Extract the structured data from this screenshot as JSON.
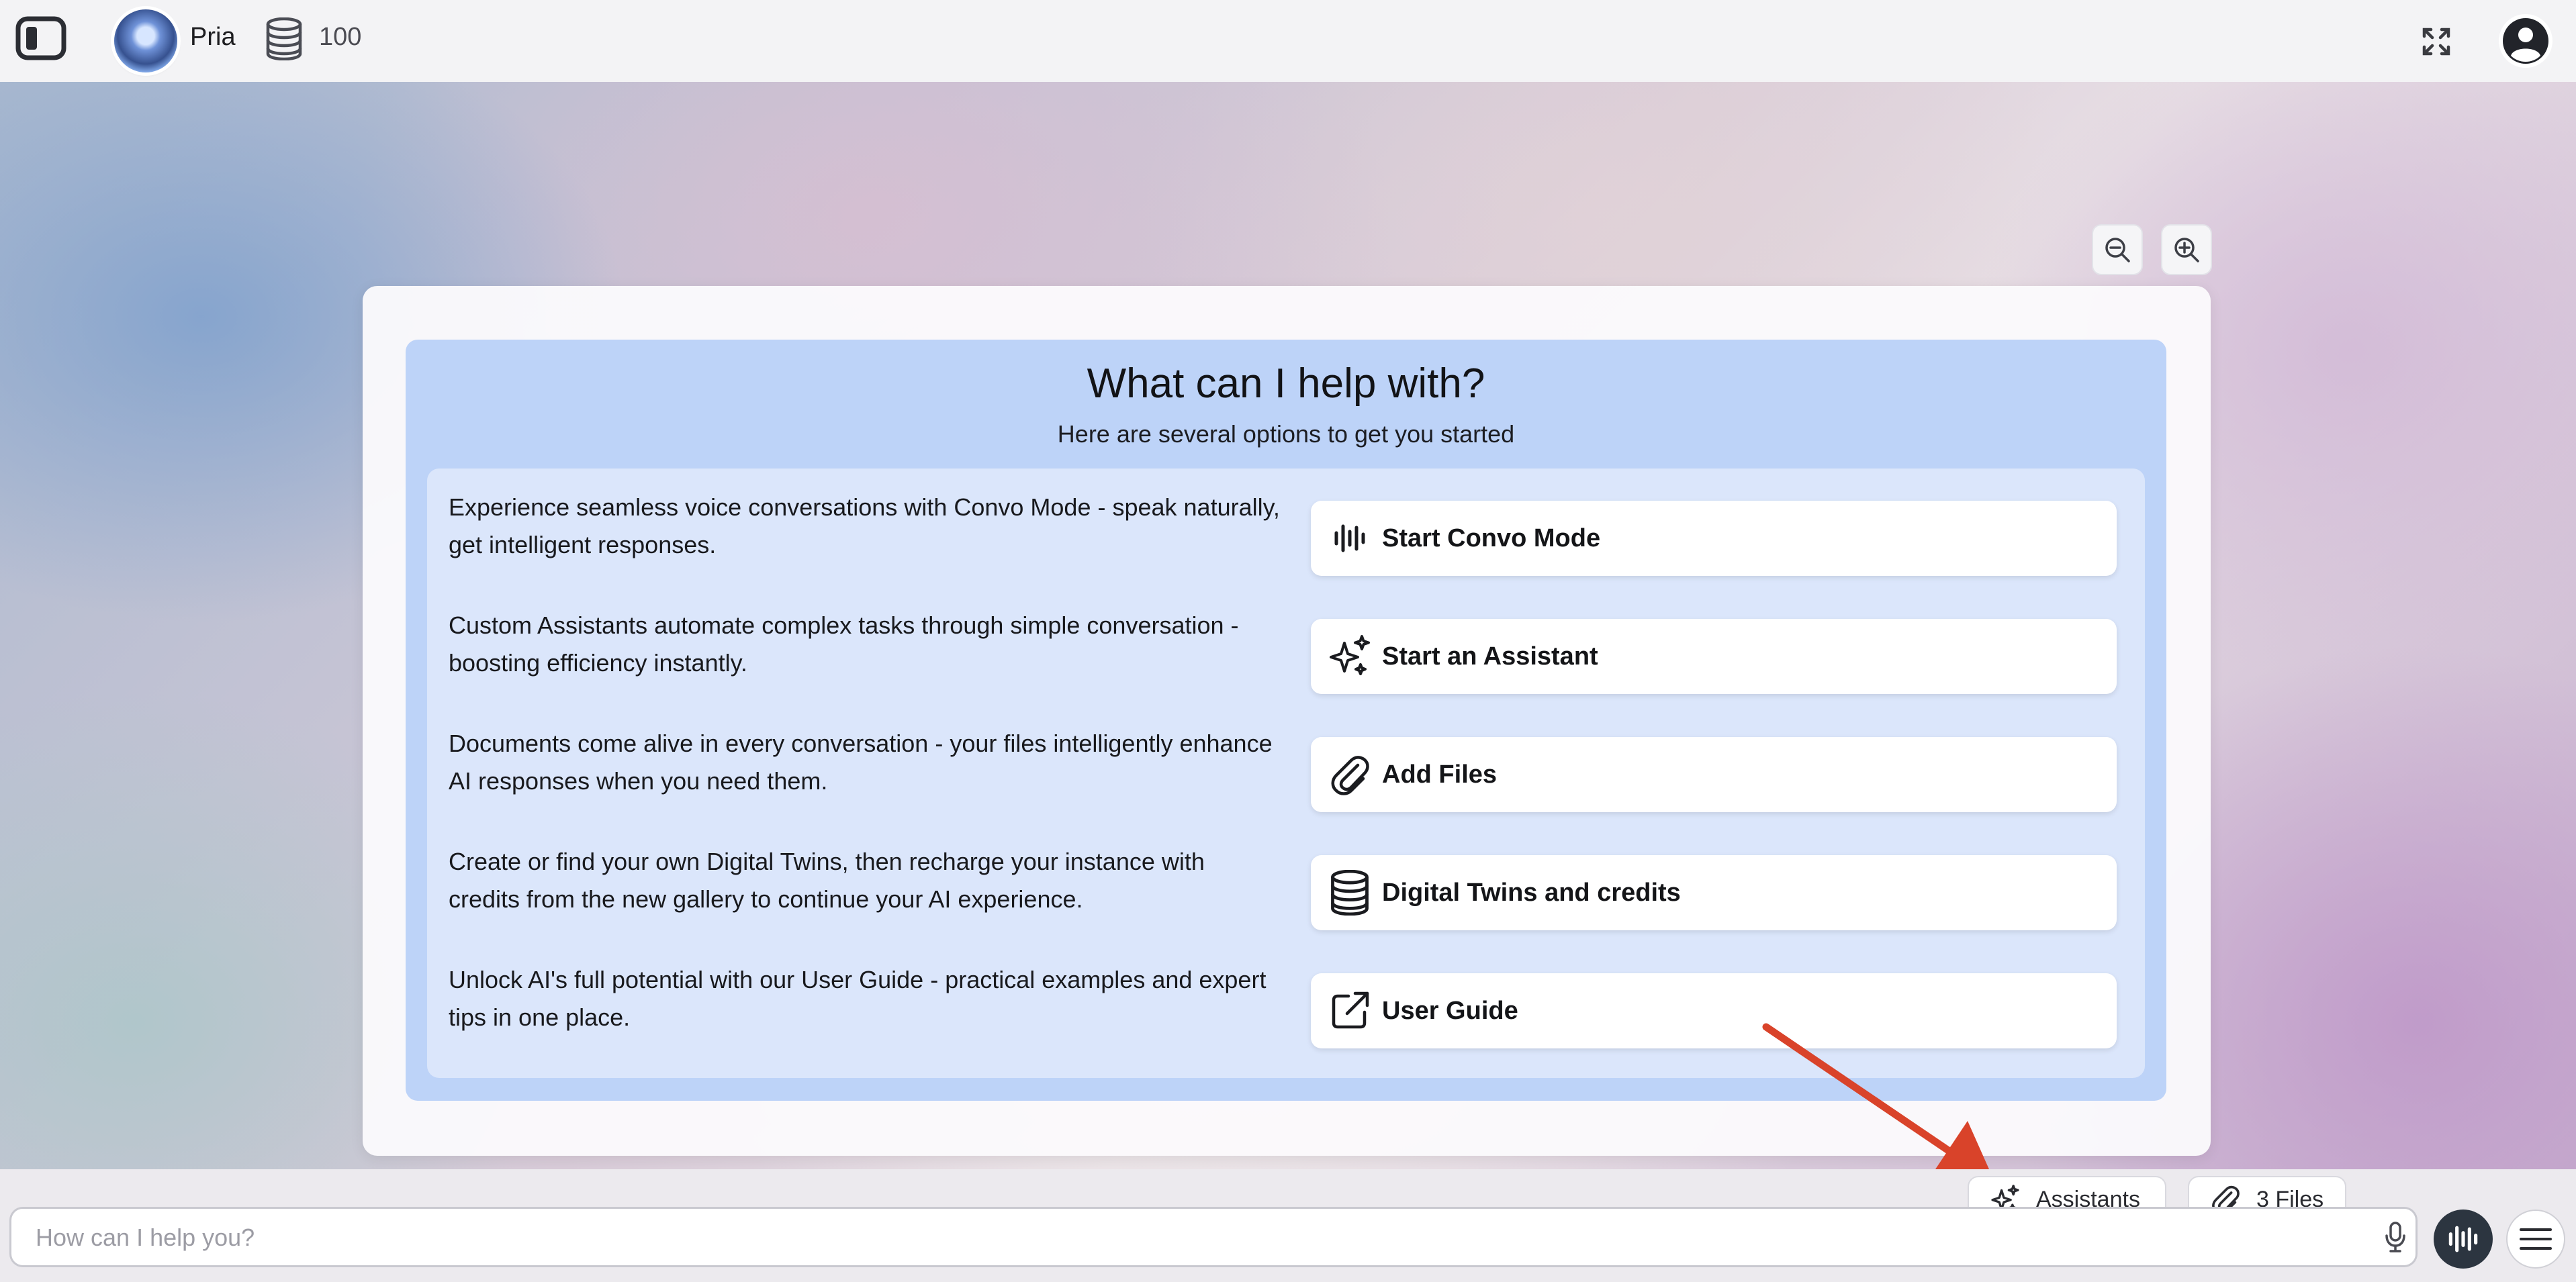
{
  "header": {
    "sidebar_icon": "sidebar-toggle-icon",
    "avatar_icon": "avatar",
    "user_name": "Pria",
    "credits_icon": "database-icon",
    "credits": "100",
    "fullscreen_icon": "fullscreen-icon",
    "profile_icon": "user-circle-icon"
  },
  "zoom": {
    "zoom_out_icon": "zoom-out-icon",
    "zoom_in_icon": "zoom-in-icon"
  },
  "welcome": {
    "title": "What can I help with?",
    "subtitle": "Here are several options to get you started",
    "options": [
      {
        "text": "Experience seamless voice conversations with Convo Mode - speak naturally, get intelligent responses.",
        "button_label": "Start Convo Mode",
        "icon": "waveform-icon"
      },
      {
        "text": "Custom Assistants automate complex tasks through simple conversation - boosting efficiency instantly.",
        "button_label": "Start an Assistant",
        "icon": "sparkles-icon"
      },
      {
        "text": "Documents come alive in every conversation - your files intelligently enhance AI responses when you need them.",
        "button_label": "Add Files",
        "icon": "paperclip-icon"
      },
      {
        "text": "Create or find your own Digital Twins, then recharge your instance with credits from the new gallery to continue your AI experience.",
        "button_label": "Digital Twins and credits",
        "icon": "database-icon"
      },
      {
        "text": "Unlock AI's full potential with our User Guide - practical examples and expert tips in one place.",
        "button_label": "User Guide",
        "icon": "external-link-icon"
      }
    ]
  },
  "composer": {
    "assistants_label": "Assistants",
    "assistants_icon": "sparkles-icon",
    "files_label": "3 Files",
    "files_icon": "paperclip-icon",
    "input_placeholder": "How can I help you?",
    "input_value": "",
    "mic_icon": "microphone-icon",
    "voice_icon": "waveform-icon",
    "menu_icon": "hamburger-menu-icon"
  },
  "colors": {
    "panel": "#bdd3f8",
    "inner_panel": "#dbe6fb",
    "arrow": "#d9432a",
    "voice_button": "#2c3540"
  }
}
